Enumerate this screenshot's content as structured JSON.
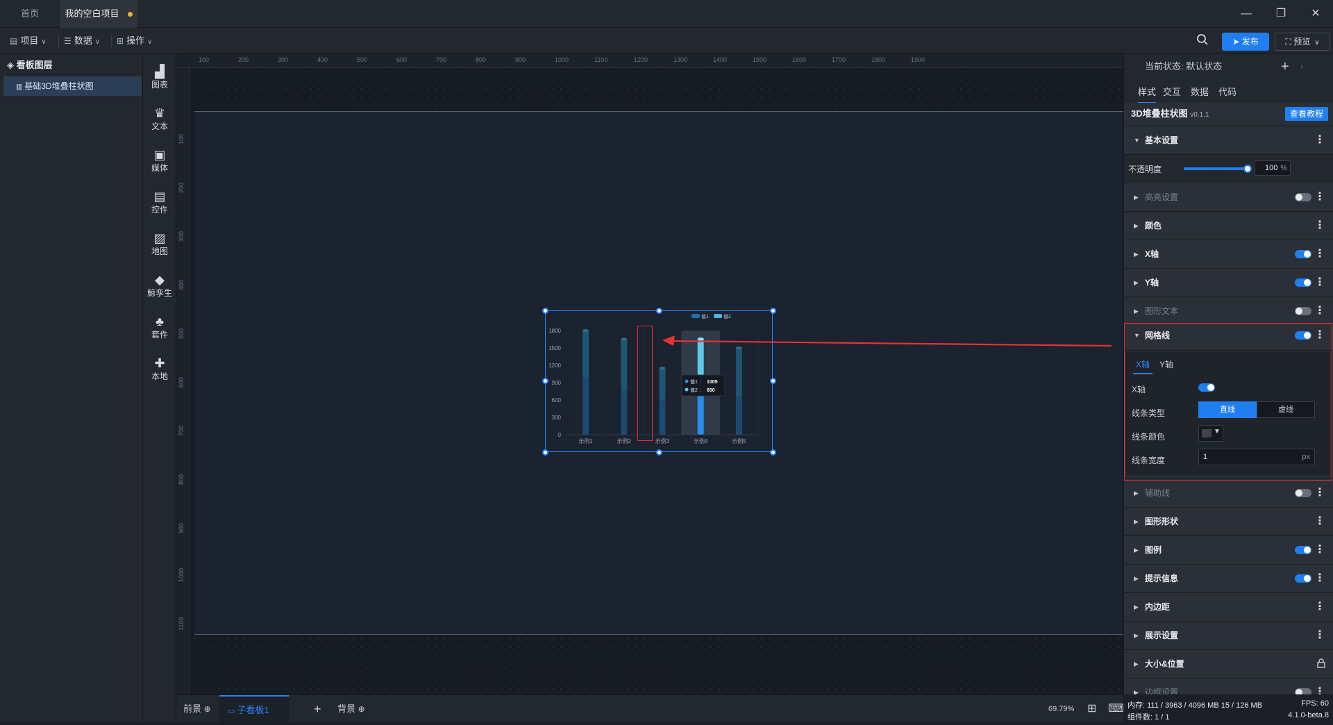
{
  "tabs": [
    {
      "label": "首页"
    },
    {
      "label": "我的空白项目"
    }
  ],
  "window_controls": {
    "minimize": "—",
    "restore": "❐",
    "close": "✕"
  },
  "toolbar": {
    "menus": [
      {
        "label": "项目"
      },
      {
        "label": "数据"
      },
      {
        "label": "操作"
      }
    ],
    "publish": "发布",
    "preview": "预览"
  },
  "layers": {
    "title": "看板图层",
    "items": [
      {
        "label": "基础3D堆叠柱状图"
      }
    ]
  },
  "components": [
    {
      "label": "图表",
      "icon": "bar-chart-icon"
    },
    {
      "label": "文本",
      "icon": "text-icon"
    },
    {
      "label": "媒体",
      "icon": "media-icon"
    },
    {
      "label": "控件",
      "icon": "control-icon"
    },
    {
      "label": "地图",
      "icon": "map-icon"
    },
    {
      "label": "鲸孪生",
      "icon": "cube-icon"
    },
    {
      "label": "套件",
      "icon": "suite-icon"
    },
    {
      "label": "本地",
      "icon": "puzzle-icon"
    }
  ],
  "ruler": {
    "top": [
      "100",
      "200",
      "300",
      "400",
      "500",
      "600",
      "700",
      "800",
      "900",
      "1000",
      "1100",
      "1200",
      "1300",
      "1400",
      "1500",
      "1600",
      "1700",
      "1800",
      "1900"
    ],
    "left": [
      "100",
      "200",
      "300",
      "400",
      "500",
      "600",
      "700",
      "800",
      "900",
      "1000",
      "1100"
    ]
  },
  "chart_data": {
    "type": "bar",
    "categories": [
      "示例1",
      "示例2",
      "示例3",
      "示例4",
      "示例5"
    ],
    "series": [
      {
        "name": "值1",
        "values": [
          1000,
          750,
          600,
          1005,
          650
        ]
      },
      {
        "name": "值2",
        "values": [
          850,
          900,
          550,
          650,
          850
        ]
      }
    ],
    "yticks": [
      "0",
      "300",
      "600",
      "900",
      "1200",
      "1500",
      "1800"
    ],
    "ylim": [
      0,
      1800
    ],
    "legend": "top-right",
    "tooltip": {
      "rows": [
        {
          "label": "值1",
          "value": "1005"
        },
        {
          "label": "值2",
          "value": "650"
        }
      ]
    }
  },
  "bottom": {
    "foreground": "前景",
    "child": "子看板1",
    "background": "背景",
    "zoom": "69.79%"
  },
  "panel": {
    "state_label": "当前状态: 默认状态",
    "tabs": [
      "样式",
      "交互",
      "数据",
      "代码"
    ],
    "component_title": "3D堆叠柱状图",
    "version": "v0.1.1",
    "tutorial": "查看教程",
    "basic": "基本设置",
    "opacity_label": "不透明度",
    "opacity_value": "100",
    "opacity_unit": "%",
    "opacity_fraction": 1.0,
    "sections_top": [
      {
        "label": "高亮设置",
        "toggle": "off",
        "dim": true
      },
      {
        "label": "颜色",
        "toggle": "none",
        "dim": false
      },
      {
        "label": "X轴",
        "toggle": "on",
        "dim": false
      },
      {
        "label": "Y轴",
        "toggle": "on",
        "dim": false
      },
      {
        "label": "图形文本",
        "toggle": "off",
        "dim": true
      }
    ],
    "grid_section": "网格线",
    "grid_tabs": [
      "X轴",
      "Y轴"
    ],
    "grid_x_label": "X轴",
    "line_type_label": "线条类型",
    "line_type_options": [
      "直线",
      "虚线"
    ],
    "line_color_label": "线条颜色",
    "line_width_label": "线条宽度",
    "line_width_value": "1",
    "line_width_unit": "px",
    "sections_bottom": [
      {
        "label": "辅助线",
        "toggle": "off",
        "dim": true
      },
      {
        "label": "图形形状",
        "toggle": "none",
        "dim": false
      },
      {
        "label": "图例",
        "toggle": "on",
        "dim": false
      },
      {
        "label": "提示信息",
        "toggle": "on",
        "dim": false
      },
      {
        "label": "内边距",
        "toggle": "none",
        "dim": false
      },
      {
        "label": "展示设置",
        "toggle": "none",
        "dim": false
      },
      {
        "label": "大小&位置",
        "toggle": "lock",
        "dim": false
      },
      {
        "label": "边框设置",
        "toggle": "off",
        "dim": true
      }
    ]
  },
  "status": {
    "memory": "内存: 111 / 3963 / 4096 MB 15 / 126 MB",
    "fps": "FPS: 60",
    "components": "组件数: 1 / 1",
    "version": "4.1.0-beta.8"
  },
  "colors": {
    "accent": "#1f7ff0",
    "highlight": "#e43333"
  }
}
